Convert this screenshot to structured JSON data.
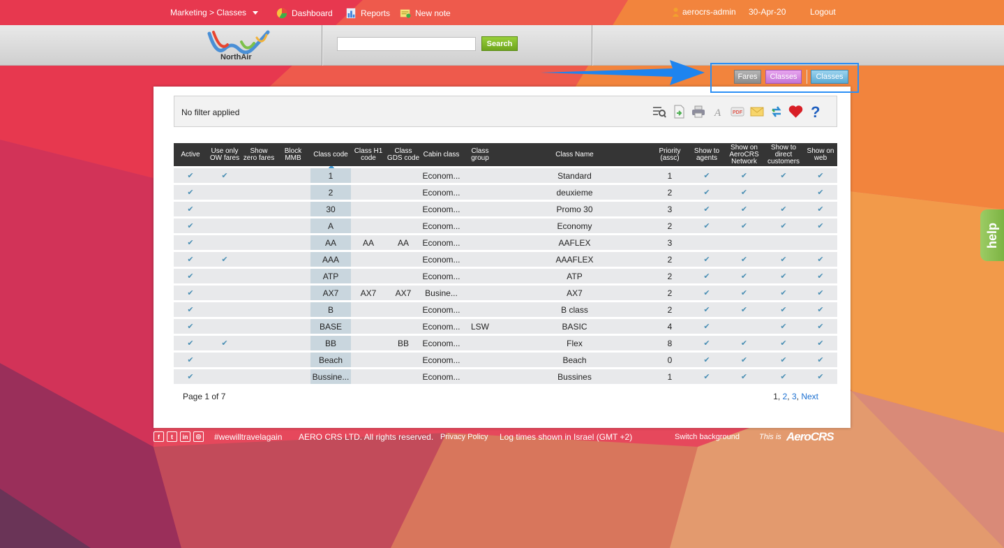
{
  "topbar": {
    "menu_label": "Marketing > Classes",
    "dashboard_label": "Dashboard",
    "reports_label": "Reports",
    "new_note_label": "New note",
    "user_label": "aerocrs-admin",
    "date_label": "30-Apr-20",
    "logout_label": "Logout"
  },
  "header": {
    "logo_text": "NorthAir",
    "search_value": "",
    "search_button": "Search"
  },
  "breadcrumb": {
    "fares": "Fares",
    "classes_parent": "Classes",
    "classes_current": "Classes"
  },
  "filter": {
    "text": "No filter applied",
    "tools": [
      "search-icon",
      "export-icon",
      "print-icon",
      "font-icon",
      "pdf-icon",
      "email-icon",
      "refresh-icon",
      "favorite-icon",
      "help-icon"
    ]
  },
  "table": {
    "headers": [
      "Active",
      "Use only OW fares",
      "Show zero fares",
      "Block MMB",
      "Class code",
      "Class H1 code",
      "Class GDS code",
      "Cabin class",
      "Class group",
      "Class Name",
      "Priority (assc)",
      "Show to agents",
      "Show on AeroCRS Network",
      "Show to direct customers",
      "Show on web"
    ],
    "check_mark": "✔",
    "rows": [
      {
        "active": "✔",
        "ow": "✔",
        "zero": "",
        "mmb": "",
        "code": "1",
        "h1": "",
        "gds": "",
        "cabin": "Econom...",
        "group": "",
        "name": "Standard",
        "priority": "1",
        "agents": "✔",
        "network": "✔",
        "direct": "✔",
        "web": "✔"
      },
      {
        "active": "✔",
        "ow": "",
        "zero": "",
        "mmb": "",
        "code": "2",
        "h1": "",
        "gds": "",
        "cabin": "Econom...",
        "group": "",
        "name": "deuxieme",
        "priority": "2",
        "agents": "✔",
        "network": "✔",
        "direct": "",
        "web": "✔"
      },
      {
        "active": "✔",
        "ow": "",
        "zero": "",
        "mmb": "",
        "code": "30",
        "h1": "",
        "gds": "",
        "cabin": "Econom...",
        "group": "",
        "name": "Promo 30",
        "priority": "3",
        "agents": "✔",
        "network": "✔",
        "direct": "✔",
        "web": "✔"
      },
      {
        "active": "✔",
        "ow": "",
        "zero": "",
        "mmb": "",
        "code": "A",
        "h1": "",
        "gds": "",
        "cabin": "Econom...",
        "group": "",
        "name": "Economy",
        "priority": "2",
        "agents": "✔",
        "network": "✔",
        "direct": "✔",
        "web": "✔"
      },
      {
        "active": "✔",
        "ow": "",
        "zero": "",
        "mmb": "",
        "code": "AA",
        "h1": "AA",
        "gds": "AA",
        "cabin": "Econom...",
        "group": "",
        "name": "AAFLEX",
        "priority": "3",
        "agents": "",
        "network": "",
        "direct": "",
        "web": ""
      },
      {
        "active": "✔",
        "ow": "✔",
        "zero": "",
        "mmb": "",
        "code": "AAA",
        "h1": "",
        "gds": "",
        "cabin": "Econom...",
        "group": "",
        "name": "AAAFLEX",
        "priority": "2",
        "agents": "✔",
        "network": "✔",
        "direct": "✔",
        "web": "✔"
      },
      {
        "active": "✔",
        "ow": "",
        "zero": "",
        "mmb": "",
        "code": "ATP",
        "h1": "",
        "gds": "",
        "cabin": "Econom...",
        "group": "",
        "name": "ATP",
        "priority": "2",
        "agents": "✔",
        "network": "✔",
        "direct": "✔",
        "web": "✔"
      },
      {
        "active": "✔",
        "ow": "",
        "zero": "",
        "mmb": "",
        "code": "AX7",
        "h1": "AX7",
        "gds": "AX7",
        "cabin": "Busine...",
        "group": "",
        "name": "AX7",
        "priority": "2",
        "agents": "✔",
        "network": "✔",
        "direct": "✔",
        "web": "✔"
      },
      {
        "active": "✔",
        "ow": "",
        "zero": "",
        "mmb": "",
        "code": "B",
        "h1": "",
        "gds": "",
        "cabin": "Econom...",
        "group": "",
        "name": "B class",
        "priority": "2",
        "agents": "✔",
        "network": "✔",
        "direct": "✔",
        "web": "✔"
      },
      {
        "active": "✔",
        "ow": "",
        "zero": "",
        "mmb": "",
        "code": "BASE",
        "h1": "",
        "gds": "",
        "cabin": "Econom...",
        "group": "LSW",
        "name": "BASIC",
        "priority": "4",
        "agents": "✔",
        "network": "",
        "direct": "✔",
        "web": "✔"
      },
      {
        "active": "✔",
        "ow": "✔",
        "zero": "",
        "mmb": "",
        "code": "BB",
        "h1": "",
        "gds": "BB",
        "cabin": "Econom...",
        "group": "",
        "name": "Flex",
        "priority": "8",
        "agents": "✔",
        "network": "✔",
        "direct": "✔",
        "web": "✔"
      },
      {
        "active": "✔",
        "ow": "",
        "zero": "",
        "mmb": "",
        "code": "Beach",
        "h1": "",
        "gds": "",
        "cabin": "Econom...",
        "group": "",
        "name": "Beach",
        "priority": "0",
        "agents": "✔",
        "network": "✔",
        "direct": "✔",
        "web": "✔"
      },
      {
        "active": "✔",
        "ow": "",
        "zero": "",
        "mmb": "",
        "code": "Bussine...",
        "h1": "",
        "gds": "",
        "cabin": "Econom...",
        "group": "",
        "name": "Bussines",
        "priority": "1",
        "agents": "✔",
        "network": "✔",
        "direct": "✔",
        "web": "✔"
      }
    ],
    "page_info": "Page 1 of 7",
    "pager": {
      "p1": "1",
      "p2": "2",
      "p3": "3",
      "next": "Next"
    }
  },
  "footer": {
    "hashtag": "#wewilltravelagain",
    "copyright": "AERO CRS LTD. All rights reserved.",
    "privacy": "Privacy Policy",
    "log_times": "Log times shown in Israel (GMT +2)",
    "switch_bg": "Switch background",
    "this_is": "This is",
    "brand": "AeroCRS"
  },
  "help_tab": "help",
  "colors": {
    "accent": "#2b8ff5",
    "search_button": "#7cb342",
    "header_row": "#353535",
    "check": "#4a8fb4",
    "link": "#1a6fd1"
  }
}
